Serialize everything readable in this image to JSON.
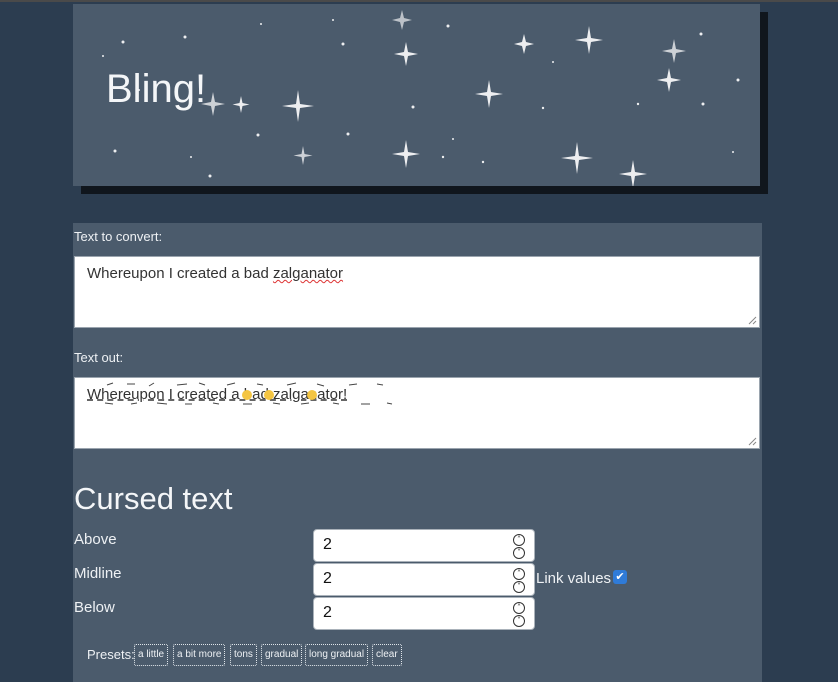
{
  "banner": {
    "title": "Bling!"
  },
  "input": {
    "label": "Text to convert:",
    "value_prefix": "Whereupon I created a bad ",
    "value_misspelled": "zalganator"
  },
  "output": {
    "label": "Text out:",
    "value": "Whereupon I created a bad zalganator!"
  },
  "cursed": {
    "heading": "Cursed text",
    "above": {
      "label": "Above",
      "value": "2"
    },
    "midline": {
      "label": "Midline",
      "value": "2"
    },
    "below": {
      "label": "Below",
      "value": "2"
    },
    "link_label": "Link values",
    "link_checked": true
  },
  "presets": {
    "label": "Presets:",
    "items": [
      "a little",
      "a bit more",
      "tons",
      "gradual",
      "long gradual",
      "clear"
    ]
  },
  "colors": {
    "page_bg": "#2c3d50",
    "panel_bg": "#4b5b6c",
    "checkbox": "#2f7bd8"
  }
}
